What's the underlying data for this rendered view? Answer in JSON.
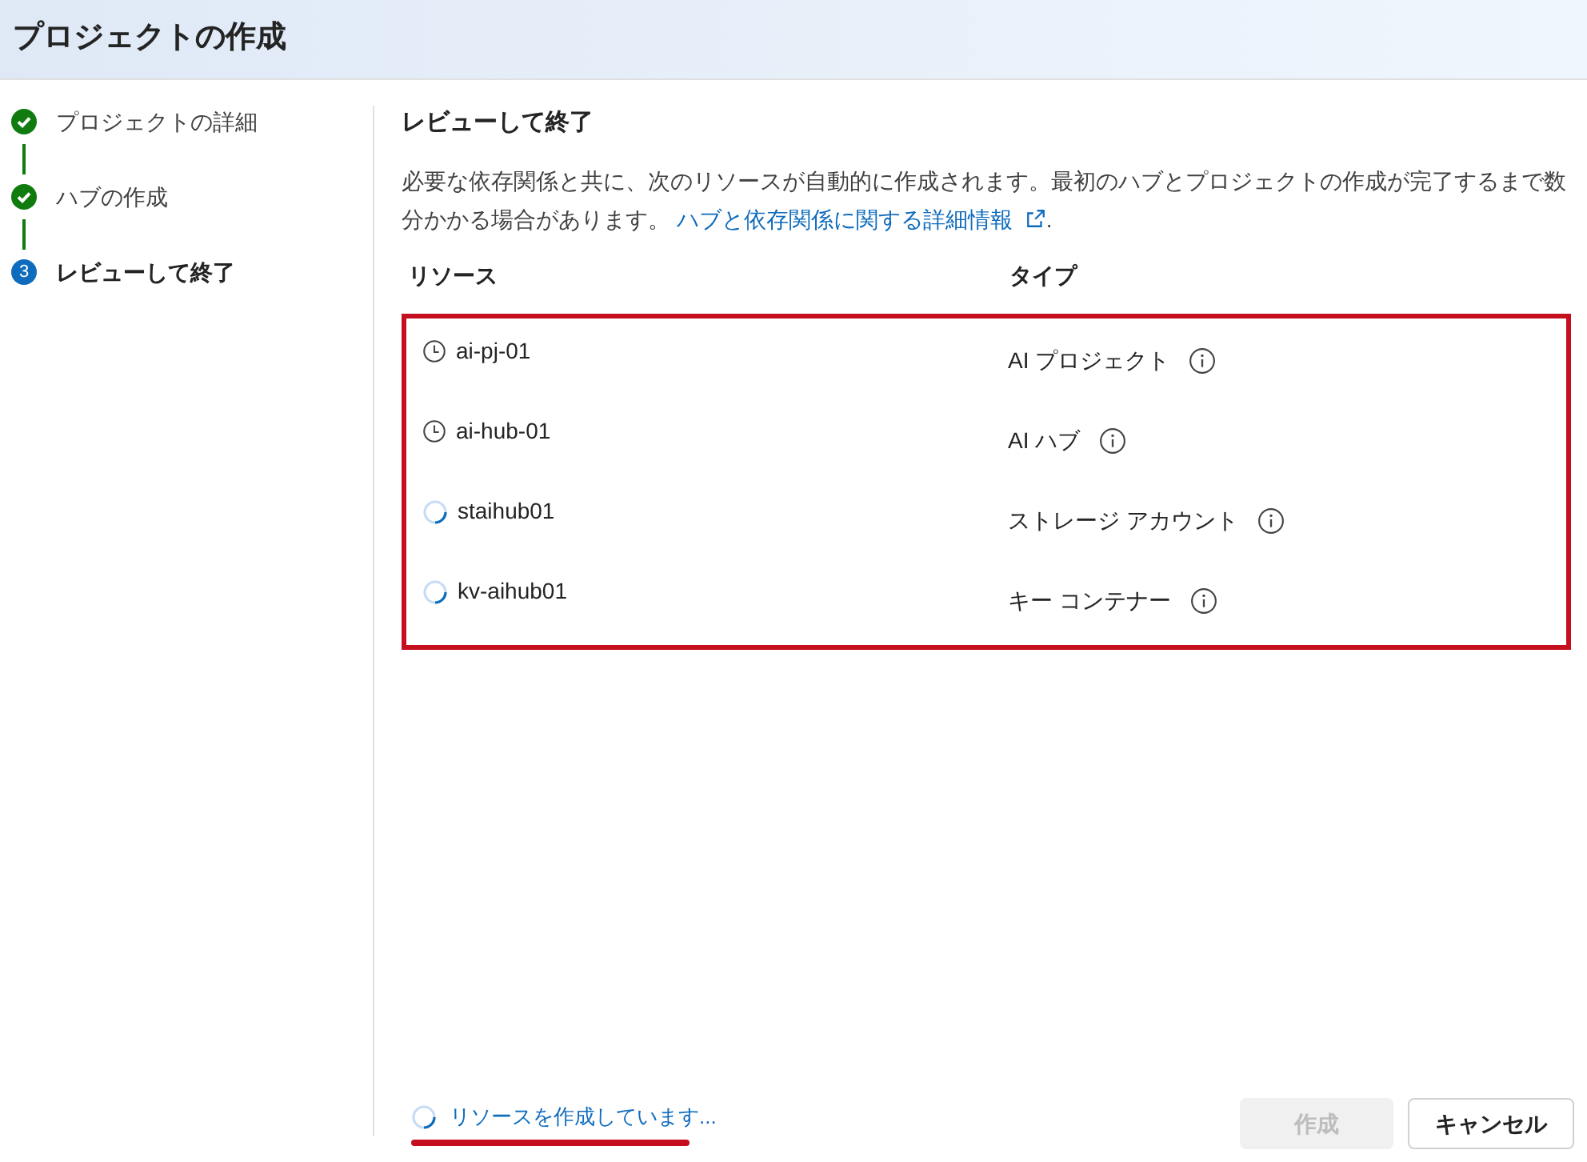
{
  "window": {
    "title": "プロジェクトの作成"
  },
  "steps": [
    {
      "label": "プロジェクトの詳細",
      "kind": "done"
    },
    {
      "label": "ハブの作成",
      "kind": "done"
    },
    {
      "label": "レビューして終了",
      "kind": "current",
      "number": "3"
    }
  ],
  "section": {
    "title": "レビューして終了",
    "description": "必要な依存関係と共に、次のリソースが自動的に作成されます。最初のハブとプロジェクトの作成が完了するまで数分かかる場合があります。",
    "link": "ハブと依存関係に関する詳細情報",
    "after_link": "."
  },
  "table": {
    "highlighted": true,
    "columns": [
      "リソース",
      "タイプ"
    ],
    "rows": [
      {
        "kind": "pending",
        "name": "ai-pj-01",
        "type": "AI プロジェクト"
      },
      {
        "kind": "pending",
        "name": "ai-hub-01",
        "type": "AI ハブ"
      },
      {
        "kind": "creating",
        "name": "staihub01",
        "type": "ストレージ アカウント"
      },
      {
        "kind": "creating",
        "name": "kv-aihub01",
        "type": "キー コンテナー"
      }
    ]
  },
  "status_bar": {
    "text": "リソースを作成しています...",
    "underlined": true
  },
  "buttons": [
    {
      "label": "作成",
      "disabled": true
    },
    {
      "label": "キャンセル",
      "disabled": false
    }
  ]
}
